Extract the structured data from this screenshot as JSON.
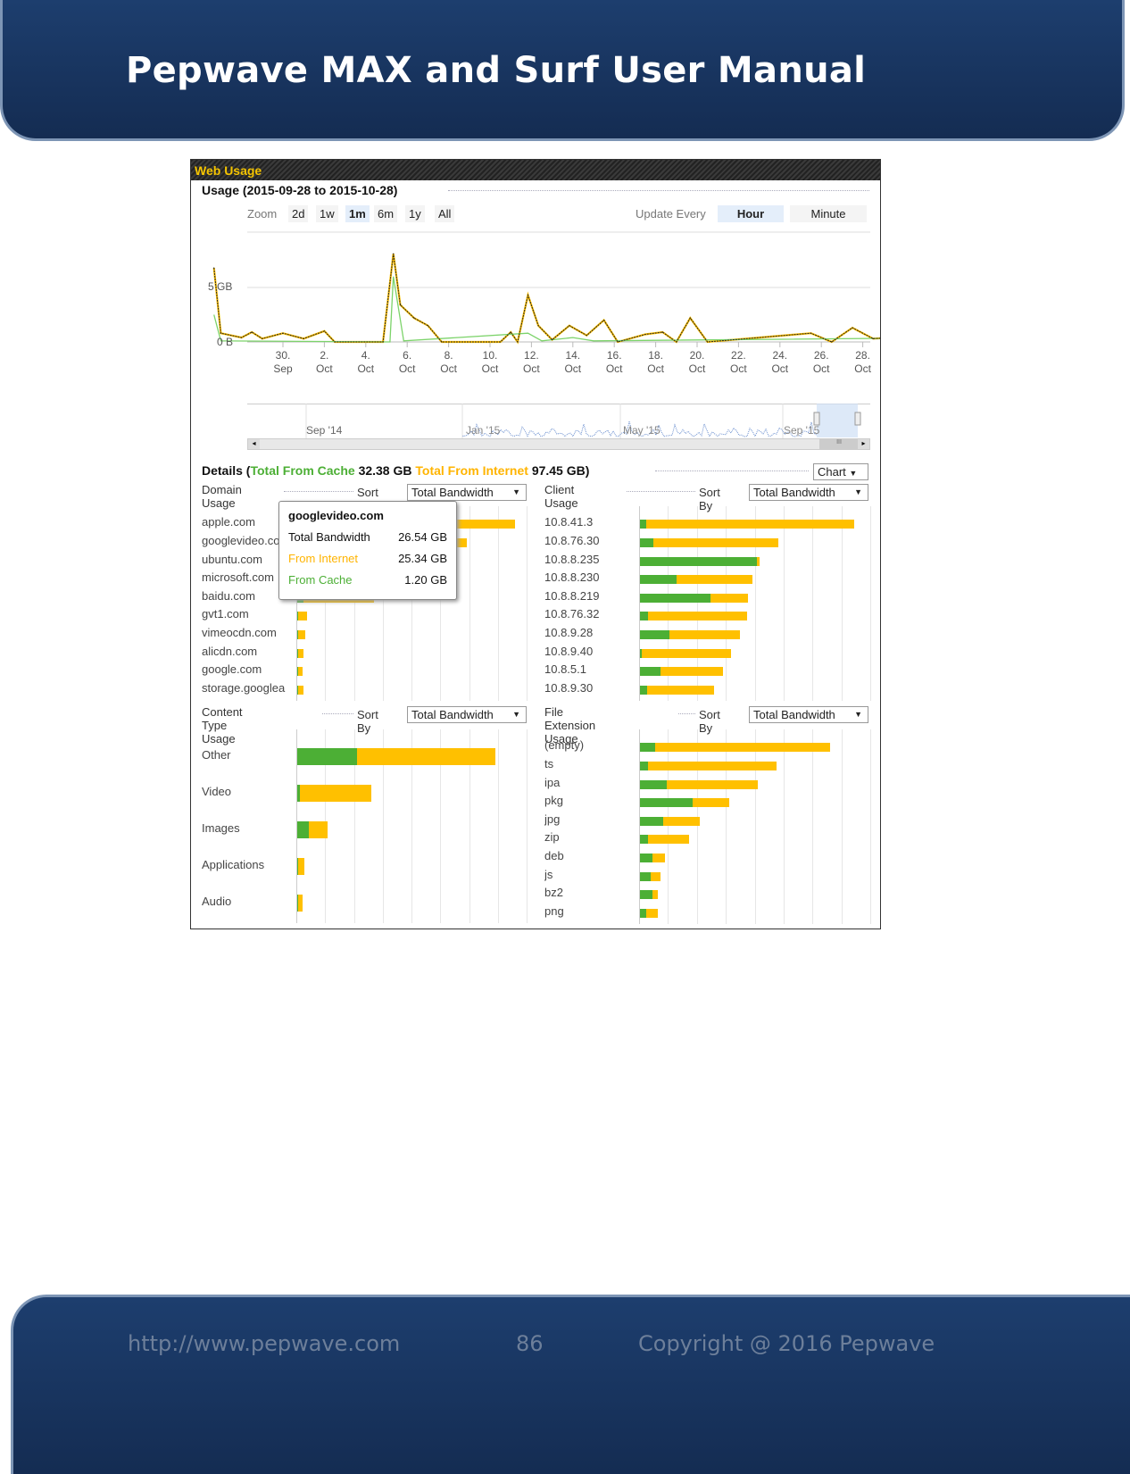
{
  "header": {
    "title": "Pepwave MAX and Surf User Manual"
  },
  "footer": {
    "url": "http://www.pepwave.com",
    "page": "86",
    "copyright": "Copyright @ 2016 Pepwave"
  },
  "panel": {
    "title": "Web Usage",
    "usage_title": "Usage (2015-09-28 to 2015-10-28)",
    "zoom_label": "Zoom",
    "zoom_options": [
      "2d",
      "1w",
      "1m",
      "6m",
      "1y",
      "All"
    ],
    "zoom_selected": "1m",
    "update_label": "Update Every",
    "update_options": [
      "Hour",
      "Minute"
    ],
    "update_selected": "Hour",
    "y_ticks": [
      "5 GB",
      "0 B"
    ],
    "x_ticks": [
      [
        "30.",
        "Sep"
      ],
      [
        "2.",
        "Oct"
      ],
      [
        "4.",
        "Oct"
      ],
      [
        "6.",
        "Oct"
      ],
      [
        "8.",
        "Oct"
      ],
      [
        "10.",
        "Oct"
      ],
      [
        "12.",
        "Oct"
      ],
      [
        "14.",
        "Oct"
      ],
      [
        "16.",
        "Oct"
      ],
      [
        "18.",
        "Oct"
      ],
      [
        "20.",
        "Oct"
      ],
      [
        "22.",
        "Oct"
      ],
      [
        "24.",
        "Oct"
      ],
      [
        "26.",
        "Oct"
      ],
      [
        "28.",
        "Oct"
      ]
    ],
    "navigator_labels": [
      "Sep '14",
      "Jan '15",
      "May '15",
      "Sep '15"
    ],
    "details": {
      "prefix": "Details (",
      "cache_label": "Total From Cache",
      "cache_value": "32.38 GB",
      "internet_label": "Total From Internet",
      "internet_value": "97.45 GB",
      "suffix": ")",
      "view_select": "Chart"
    },
    "sort_label": "Sort By",
    "sort_value": "Total Bandwidth"
  },
  "colors": {
    "cache": "#4caf35",
    "internet": "#ffc000",
    "accent": "#f5c400",
    "header_bg": "#1a3766"
  },
  "tooltip": {
    "title": "googlevideo.com",
    "total_label": "Total Bandwidth",
    "total_value": "26.54 GB",
    "internet_label": "From Internet",
    "internet_value": "25.34 GB",
    "cache_label": "From Cache",
    "cache_value": "1.20 GB"
  },
  "chart_data": [
    {
      "type": "line",
      "title": "Usage (2015-09-28 to 2015-10-28)",
      "ylabel": "",
      "ylim_gb": [
        0,
        8.5
      ],
      "y_ticks": [
        "0 B",
        "5 GB"
      ],
      "series": [
        {
          "name": "Total",
          "unit": "GB",
          "points": [
            [
              "2015-09-28 08:00",
              6.8
            ],
            [
              "2015-09-28 12:00",
              0.8
            ],
            [
              "2015-09-29 00:00",
              0.4
            ],
            [
              "2015-09-29 06:00",
              0.9
            ],
            [
              "2015-09-29 12:00",
              0.3
            ],
            [
              "2015-09-30 00:00",
              0.8
            ],
            [
              "2015-09-30 12:00",
              0.3
            ],
            [
              "2015-10-01 00:00",
              1.0
            ],
            [
              "2015-10-01 06:00",
              0
            ],
            [
              "2015-10-02 10:00",
              0
            ],
            [
              "2015-10-02 16:00",
              8.1
            ],
            [
              "2015-10-02 20:00",
              3.4
            ],
            [
              "2015-10-03 04:00",
              2.2
            ],
            [
              "2015-10-03 12:00",
              1.5
            ],
            [
              "2015-10-03 20:00",
              0
            ],
            [
              "2015-10-05 06:00",
              0
            ],
            [
              "2015-10-05 12:00",
              0.9
            ],
            [
              "2015-10-05 16:00",
              0
            ],
            [
              "2015-10-05 22:00",
              4.3
            ],
            [
              "2015-10-06 04:00",
              1.5
            ],
            [
              "2015-10-06 12:00",
              0.2
            ],
            [
              "2015-10-06 22:00",
              1.5
            ],
            [
              "2015-10-07 08:00",
              0.6
            ],
            [
              "2015-10-07 18:00",
              2.0
            ],
            [
              "2015-10-08 02:00",
              0
            ],
            [
              "2015-10-08 18:00",
              0.7
            ],
            [
              "2015-10-09 04:00",
              0.9
            ],
            [
              "2015-10-09 12:00",
              0
            ],
            [
              "2015-10-09 20:00",
              2.2
            ],
            [
              "2015-10-10 06:00",
              0
            ],
            [
              "2015-10-12 18:00",
              0.8
            ],
            [
              "2015-10-13 06:00",
              0
            ],
            [
              "2015-10-13 18:00",
              1.3
            ],
            [
              "2015-10-14 06:00",
              0.3
            ],
            [
              "2015-10-15 06:00",
              0.5
            ],
            [
              "2015-10-16 00:00",
              0.3
            ],
            [
              "2015-10-16 12:00",
              1.4
            ],
            [
              "2015-10-16 20:00",
              0
            ],
            [
              "2015-10-18 12:00",
              0.8
            ],
            [
              "2015-10-18 16:00",
              0
            ],
            [
              "2015-10-19 12:00",
              0.7
            ],
            [
              "2015-10-20 12:00",
              0.5
            ],
            [
              "2015-10-21 12:00",
              0.5
            ],
            [
              "2015-10-22 10:00",
              0
            ],
            [
              "2015-10-22 14:00",
              2.5
            ],
            [
              "2015-10-22 20:00",
              0.2
            ],
            [
              "2015-10-23 10:00",
              2.5
            ],
            [
              "2015-10-23 16:00",
              0.6
            ],
            [
              "2015-10-23 22:00",
              1.3
            ],
            [
              "2015-10-24 06:00",
              0
            ],
            [
              "2015-10-25 06:00",
              0.7
            ],
            [
              "2015-10-25 16:00",
              0
            ],
            [
              "2015-10-26 12:00",
              0.5
            ],
            [
              "2015-10-27 12:00",
              0.3
            ],
            [
              "2015-10-27 18:00",
              2.2
            ],
            [
              "2015-10-28 06:00",
              0.3
            ],
            [
              "2015-10-28 13:00",
              0
            ]
          ]
        },
        {
          "name": "From Cache",
          "unit": "GB",
          "points": [
            [
              "2015-09-28 08:00",
              2.5
            ],
            [
              "2015-09-28 12:00",
              0.1
            ],
            [
              "2015-10-02 14:00",
              0
            ],
            [
              "2015-10-02 16:00",
              6.0
            ],
            [
              "2015-10-02 22:00",
              0.1
            ],
            [
              "2015-10-05 22:00",
              0.8
            ],
            [
              "2015-10-06 06:00",
              0.1
            ],
            [
              "2015-10-07 00:00",
              0.4
            ],
            [
              "2015-10-07 12:00",
              0.1
            ],
            [
              "2015-10-22 14:00",
              0.6
            ],
            [
              "2015-10-22 20:00",
              0.1
            ],
            [
              "2015-10-28 13:00",
              0
            ]
          ]
        }
      ]
    },
    {
      "type": "bar",
      "title": "Domain Usage",
      "orientation": "horizontal",
      "stacked": true,
      "categories": [
        "apple.com",
        "googlevideo.com",
        "ubuntu.com",
        "microsoft.com",
        "baidu.com",
        "gvt1.com",
        "vimeocdn.com",
        "alicdn.com",
        "google.com",
        "storage.googleapis.com"
      ],
      "series": [
        {
          "name": "From Cache",
          "values": [
            0.3,
            1.2,
            3,
            2,
            1,
            0.1,
            0.15,
            0.15,
            0.1,
            0.1
          ]
        },
        {
          "name": "From Internet",
          "values": [
            33.8,
            25.34,
            18,
            14,
            11,
            1.4,
            1.1,
            0.8,
            0.8,
            0.9
          ]
        }
      ]
    },
    {
      "type": "bar",
      "title": "Client Usage",
      "orientation": "horizontal",
      "stacked": true,
      "categories": [
        "10.8.41.3",
        "10.8.76.30",
        "10.8.8.235",
        "10.8.8.230",
        "10.8.8.219",
        "10.8.76.32",
        "10.8.9.28",
        "10.8.9.40",
        "10.8.5.1",
        "10.8.9.30"
      ],
      "series": [
        {
          "name": "From Cache",
          "values": [
            2.7,
            5.8,
            50.4,
            15.8,
            30.4,
            3.5,
            12.7,
            0.8,
            8.8,
            3
          ]
        },
        {
          "name": "From Internet",
          "values": [
            90,
            54,
            1.5,
            32.7,
            16.2,
            43,
            30.4,
            38.5,
            27,
            29
          ]
        }
      ]
    },
    {
      "type": "bar",
      "title": "Content Type Usage",
      "orientation": "horizontal",
      "stacked": true,
      "categories": [
        "Other",
        "Video",
        "Images",
        "Applications",
        "Audio"
      ],
      "series": [
        {
          "name": "From Cache",
          "values": [
            26,
            1.2,
            5,
            0.4,
            0.4
          ]
        },
        {
          "name": "From Internet",
          "values": [
            60,
            31,
            8,
            2.7,
            1.9
          ]
        }
      ]
    },
    {
      "type": "bar",
      "title": "File Extension Usage",
      "orientation": "horizontal",
      "stacked": true,
      "categories": [
        "(empty)",
        "ts",
        "ipa",
        "pkg",
        "jpg",
        "zip",
        "deb",
        "js",
        "bz2",
        "png"
      ],
      "series": [
        {
          "name": "From Cache",
          "values": [
            6.6,
            3.5,
            11.6,
            22.8,
            10,
            3.5,
            5.4,
            4.6,
            5.4,
            2.7
          ]
        },
        {
          "name": "From Internet",
          "values": [
            75.7,
            55.6,
            39.4,
            15.8,
            15.8,
            17.8,
            5.4,
            4.2,
            2.3,
            5
          ]
        }
      ]
    }
  ]
}
